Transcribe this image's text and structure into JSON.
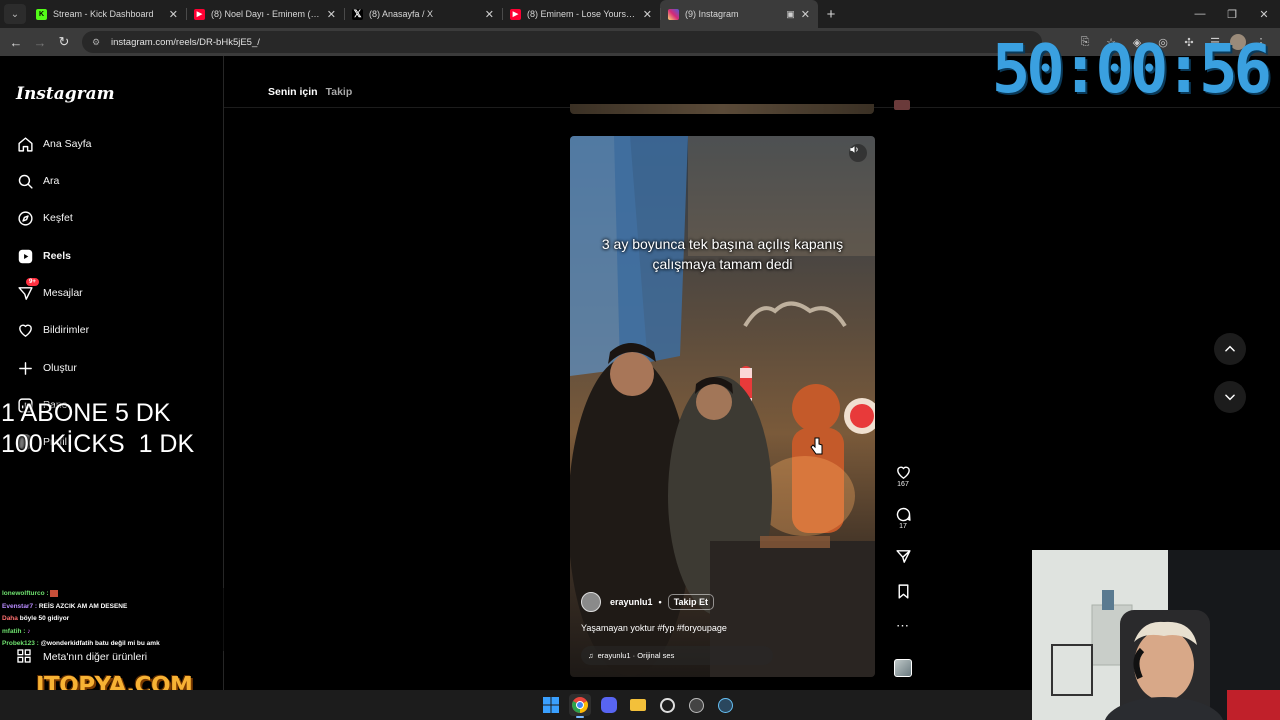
{
  "browser": {
    "tabs": [
      {
        "label": "Stream - Kick Dashboard",
        "icon": "kick-icon",
        "color": "#53fc18",
        "active": false
      },
      {
        "label": "(8) Noel Dayı - Eminem (Yetişkin",
        "icon": "youtube-icon",
        "color": "#ff0033",
        "active": false
      },
      {
        "label": "(8) Anasayfa / X",
        "icon": "x-icon",
        "color": "#ffffff",
        "active": false
      },
      {
        "label": "(8) Eminem - Lose Yourself - Yo",
        "icon": "youtube-icon",
        "color": "#ff0033",
        "active": false
      },
      {
        "label": "(9) Instagram",
        "icon": "instagram-icon",
        "color": "#e1306c",
        "active": true
      }
    ],
    "url": "instagram.com/reels/DR-bHk5jE5_/"
  },
  "timer": "50:00:56",
  "sidebar": {
    "logo": "Instagram",
    "items": [
      {
        "label": "Ana Sayfa",
        "icon": "home-icon"
      },
      {
        "label": "Ara",
        "icon": "search-icon"
      },
      {
        "label": "Keşfet",
        "icon": "compass-icon"
      },
      {
        "label": "Reels",
        "icon": "reels-icon"
      },
      {
        "label": "Mesajlar",
        "icon": "messenger-icon",
        "badge": "9+"
      },
      {
        "label": "Bildirimler",
        "icon": "heart-icon"
      },
      {
        "label": "Oluştur",
        "icon": "plus-icon"
      },
      {
        "label": "Pano",
        "icon": "dashboard-icon"
      },
      {
        "label": "Profil",
        "icon": "avatar-icon"
      }
    ],
    "meta_more": "Meta'nın diğer ürünleri"
  },
  "overlay": {
    "abone_line1": "1 ABONE 5 DK",
    "abone_line2": "100 KİCKS  1 DK",
    "chat": [
      {
        "user": "lonewolfturco :",
        "msg": ""
      },
      {
        "user": "Evenstar7 :",
        "msg": "REİS AZCIK AM AM DESENE"
      },
      {
        "user": "Daha",
        "msg": "böyle 50 gidiyor"
      },
      {
        "user": "mfatih :",
        "msg": ""
      },
      {
        "user": "Probek123 :",
        "msg": "@wonderkidfatih batu değil mi bu amk"
      }
    ],
    "sponsor": "ITOPYA.COM"
  },
  "feed": {
    "tabs": [
      "Senin için",
      "Takip"
    ]
  },
  "reel": {
    "caption": "3 ay boyunca tek başına açılış kapanış çalışmaya tamam dedi",
    "username": "erayunlu1",
    "follow_label": "Takip Et",
    "description": "Yaşamayan yoktur #fyp #foryoupage",
    "audio": "erayunlu1 · Orijinal ses",
    "likes": "167",
    "comments": "17"
  },
  "colors": {
    "timer": "#3aa0e0",
    "badge": "#ff3040",
    "sponsor": "#f7b234",
    "chat_user": "#6ee06e"
  }
}
